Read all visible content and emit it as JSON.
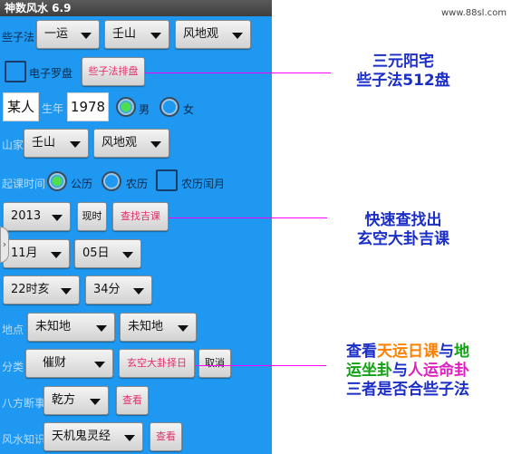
{
  "window": {
    "title": "神数风水 6.9"
  },
  "watermark": "www.88sl.com",
  "row1": {
    "label": "些子法",
    "yun": "一运",
    "shan": "壬山",
    "view": "风地观"
  },
  "row2": {
    "checkbox_label": "电子罗盘",
    "button": "些子法排盘"
  },
  "row3": {
    "name": "某人",
    "label_year": "生年",
    "year": "1978",
    "male": "男",
    "female": "女"
  },
  "row4": {
    "label": "山家",
    "shan": "壬山",
    "view": "风地观"
  },
  "row5": {
    "label": "起课时间",
    "solar": "公历",
    "lunar": "农历",
    "leap": "农历闰月"
  },
  "row6": {
    "year": "2013",
    "now_button": "现时",
    "find_button": "查找吉课"
  },
  "row7": {
    "month": "11月",
    "day": "05日"
  },
  "row8": {
    "hour": "22时亥",
    "minute": "34分"
  },
  "row9": {
    "label": "地点",
    "place1": "未知地",
    "place2": "未知地"
  },
  "row10": {
    "label": "分类",
    "category": "催财",
    "select_button": "玄空大卦择日",
    "cancel_button": "取消"
  },
  "row11": {
    "label": "八方断事",
    "direction": "乾方",
    "view_button": "查看"
  },
  "row12": {
    "label": "风水知识",
    "book": "天机鬼灵经",
    "view_button": "查看"
  },
  "side_handle": "›",
  "callouts": {
    "c1_line1": "三元阳宅",
    "c1_line2": "些子法512盘",
    "c2_line1": "快速查找出",
    "c2_line2": "玄空大卦吉课",
    "c3_a": "查看",
    "c3_b": "天运日课",
    "c3_c": "与",
    "c3_d": "地",
    "c3_e": "运坐卦",
    "c3_f": "与",
    "c3_g": "人运命卦",
    "c3_h": "三者是否合些子法"
  },
  "colors": {
    "app_bg": "#1e98f0",
    "pointer": "#ff00ff",
    "callout": "#1b2fc8",
    "radio_on": "#4ee04a"
  }
}
